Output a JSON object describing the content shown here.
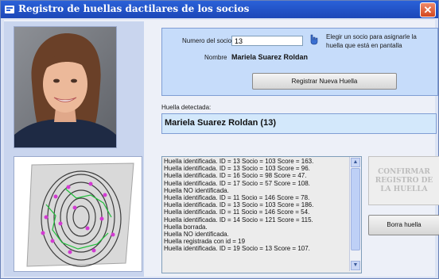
{
  "window": {
    "title": "Registro de huellas dactilares de los socios",
    "close_glyph": "✕"
  },
  "member": {
    "number_label": "Numero del socio",
    "number_value": "13",
    "pick_hint": "Elegir un socio para asignarle la huella que está en pantalla",
    "name_label": "Nombre",
    "name_value": "Mariela Suarez Roldan",
    "register_button": "Registrar Nueva Huella"
  },
  "detection": {
    "label": "Huella detectada:",
    "value": "Mariela Suarez Roldan (13)"
  },
  "log": {
    "lines": [
      "Huella identificada. ID = 13 Socio = 103 Score = 163.",
      "Huella identificada. ID = 13 Socio = 103 Score = 96.",
      "Huella identificada. ID = 16 Socio = 98 Score = 47.",
      "Huella identificada. ID = 17 Socio = 57 Score = 108.",
      "Huella NO identificada.",
      "Huella identificada. ID = 11 Socio = 146 Score = 78.",
      "Huella identificada. ID = 13 Socio = 103 Score = 186.",
      "Huella identificada. ID = 11 Socio = 146 Score = 54.",
      "Huella identificada. ID = 14 Socio = 121 Score = 115.",
      "Huella borrada.",
      "Huella NO identificada.",
      "Huella registrada con id = 19",
      "Huella identificada. ID = 19 Socio = 13 Score = 107."
    ]
  },
  "buttons": {
    "confirm": "CONFIRMAR REGISTRO DE LA HUELLA",
    "delete": "Borra huella"
  },
  "icons": {
    "app": "app-icon",
    "pick": "pointer-hand-icon",
    "scroll_up": "▲",
    "scroll_down": "▼"
  },
  "colors": {
    "titlebar": "#2a61d8",
    "panel": "#c6dcfa",
    "close": "#d2461e"
  }
}
